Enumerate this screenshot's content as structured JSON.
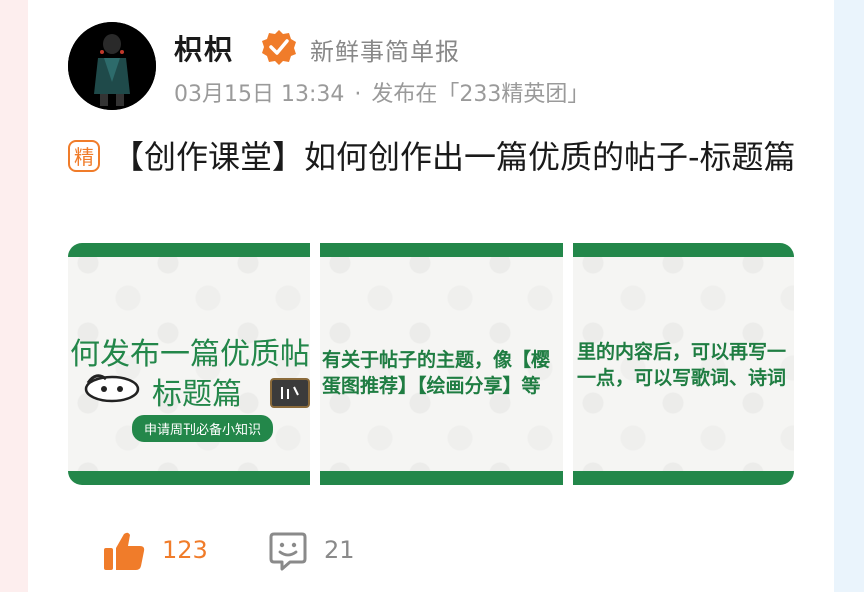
{
  "author": {
    "name": "枳枳",
    "title": "新鲜事简单报"
  },
  "meta": {
    "date": "03月15日 13:34",
    "separator": "·",
    "published_in": "发布在「233精英团」"
  },
  "post": {
    "badge": "精",
    "title": "【创作课堂】如何创作出一篇优质的帖子-标题篇"
  },
  "images": [
    {
      "line1": "何发布一篇优质帖",
      "line2": "标题篇",
      "pill": "申请周刊必备小知识"
    },
    {
      "line1": "有关于帖子的主题，像【樱",
      "line2": "蛋图推荐】【绘画分享】等"
    },
    {
      "line1": "里的内容后，可以再写一",
      "line2": "一点，可以写歌词、诗词"
    }
  ],
  "actions": {
    "like_count": "123",
    "comment_count": "21"
  },
  "colors": {
    "accent": "#f07c2a",
    "green": "#23874a"
  }
}
